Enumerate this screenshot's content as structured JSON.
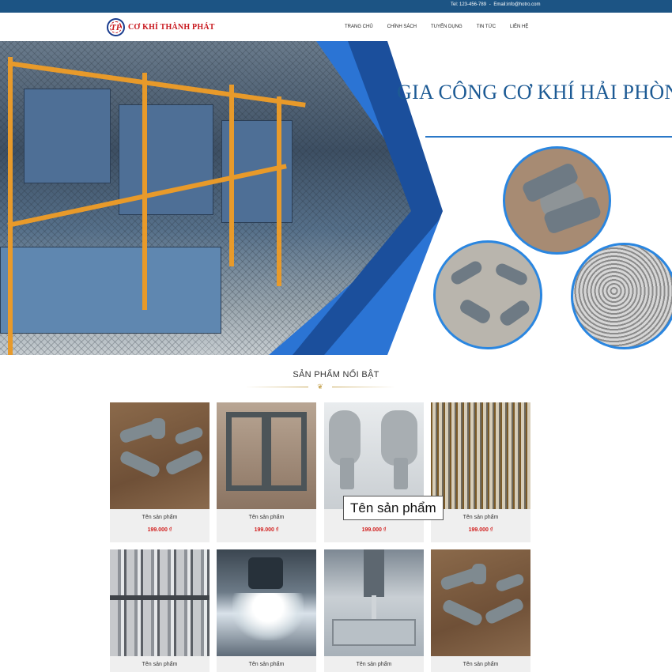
{
  "topbar": {
    "phone": "Tel: 123-456-789",
    "separator": "-",
    "email": "Email:info@hotro.com"
  },
  "header": {
    "logo_mark": "TP",
    "brand": "CƠ KHÍ THÀNH PHÁT",
    "nav": [
      "TRANG CHỦ",
      "CHÍNH SÁCH",
      "TUYỂN DỤNG",
      "TIN TỨC",
      "LIÊN HỆ"
    ]
  },
  "hero": {
    "title": "GIA CÔNG CƠ KHÍ HẢI PHÒN"
  },
  "featured": {
    "title": "SẢN PHẨM NỔI BẬT",
    "ornament": "❦"
  },
  "products": [
    {
      "name": "Tên sản phẩm",
      "price": "199.000 ₫",
      "image": "gray-brackets-on-wood"
    },
    {
      "name": "Tên sản phẩm",
      "price": "199.000 ₫",
      "image": "metal-frame"
    },
    {
      "name": "Tên sản phẩm",
      "price": "199.000 ₫",
      "image": "steel-blocks"
    },
    {
      "name": "Tên sản phẩm",
      "price": "199.000 ₫",
      "image": "bolt-rows"
    },
    {
      "name": "Tên sản phẩm",
      "price": "",
      "image": "steel-pins"
    },
    {
      "name": "Tên sản phẩm",
      "price": "",
      "image": "cnc-coolant"
    },
    {
      "name": "Tên sản phẩm",
      "price": "",
      "image": "milling-machine"
    },
    {
      "name": "Tên sản phẩm",
      "price": "",
      "image": "gray-brackets-on-wood"
    }
  ],
  "tooltip": {
    "text": "Tên sản phẩm"
  },
  "colors": {
    "topbar": "#1c5484",
    "brand_red": "#c8181e",
    "hero_blue": "#2b74d4",
    "price_red": "#d2201f",
    "ornament_gold": "#c9a95b"
  }
}
